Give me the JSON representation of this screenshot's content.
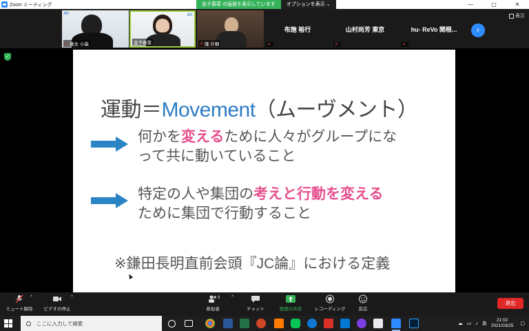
{
  "window": {
    "title": "Zoom ミーティング",
    "share_status": "金子春菜 の画面を表示しています",
    "options_label": "オプションを表示",
    "minimize": "—",
    "maximize": "▢",
    "close": "✕"
  },
  "participants": {
    "video_tiles": [
      {
        "name": "雄太 小森"
      },
      {
        "name": "金子春菜"
      },
      {
        "name": "隆 片桐"
      }
    ],
    "name_tiles": [
      "布施 裕行",
      "山村尚芳 東京",
      "hu- ReVo 関根..."
    ],
    "next_label": "›",
    "view_label": "表示"
  },
  "slide": {
    "title_ja_prefix": "運動＝",
    "title_en": "Movement",
    "title_ja_suffix": "（ムーヴメント）",
    "bullet1": {
      "part1": "何かを",
      "highlight": "変える",
      "part2": "ために人々がグループにな",
      "line2": "って共に動いていること"
    },
    "bullet2": {
      "part1": "特定の人や集団の",
      "highlight": "考えと行動を変える",
      "line2": "ために集団で行動すること"
    },
    "note": "※鎌田長明直前会頭『JC論』における定義"
  },
  "controls": {
    "mute": "ミュート解除",
    "video": "ビデオの停止",
    "participants": "参加者",
    "participant_count": "9",
    "chat": "チャット",
    "share": "画面の共有",
    "record": "レコーディング",
    "reactions": "反応",
    "end": "退出",
    "colors": {
      "share": "#35b35a",
      "end": "#e02828",
      "mic_off": "#e0453a"
    }
  },
  "taskbar": {
    "search_placeholder": "ここに入力して検索",
    "ime": "あ",
    "time": "21:02",
    "date": "2021/03/25"
  }
}
